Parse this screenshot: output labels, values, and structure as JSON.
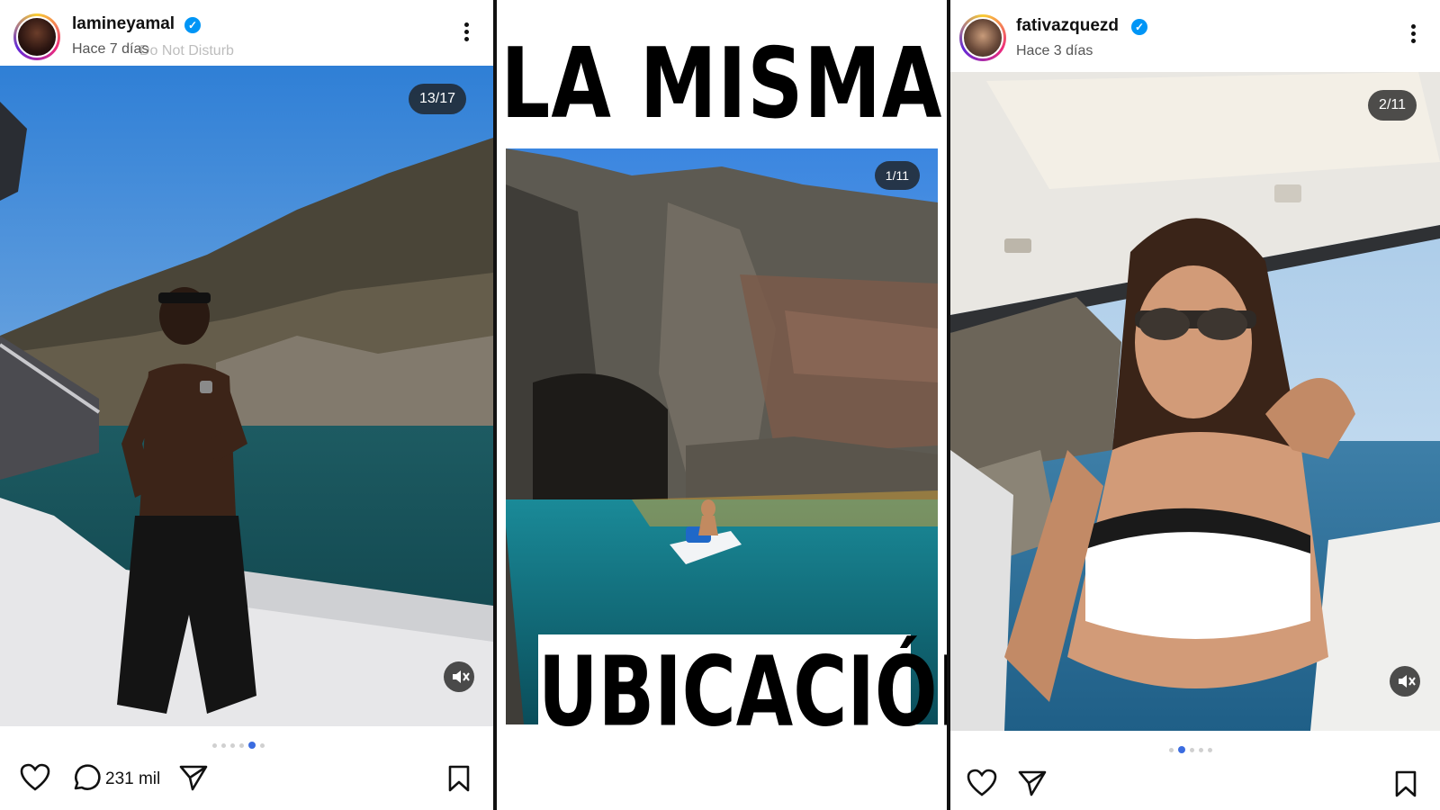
{
  "left_post": {
    "username": "lamineyamal",
    "verified_mark": "✓",
    "time": "Hace 7 días",
    "overlay_text": "Do Not Disturb",
    "counter": "13/17",
    "comments_count": "231 mil",
    "carousel": {
      "total_dots": 6,
      "active_index": 4
    },
    "icons": [
      "more-options-icon",
      "heart-icon",
      "comment-icon",
      "send-icon",
      "bookmark-icon",
      "mute-icon"
    ]
  },
  "middle": {
    "title_top": "LA MISMA",
    "title_bottom": "UBICACIÓN",
    "counter": "1/11"
  },
  "right_post": {
    "username": "fativazquezd",
    "verified_mark": "✓",
    "time": "Hace 3 días",
    "counter": "2/11",
    "carousel": {
      "total_dots": 5,
      "active_index": 1
    },
    "icons": [
      "more-options-icon",
      "heart-icon",
      "send-icon",
      "bookmark-icon",
      "mute-icon"
    ]
  },
  "colors": {
    "verified_blue": "#0095f6",
    "carousel_active": "#3b6ce0",
    "text_primary": "#111111",
    "text_secondary": "#555555"
  }
}
